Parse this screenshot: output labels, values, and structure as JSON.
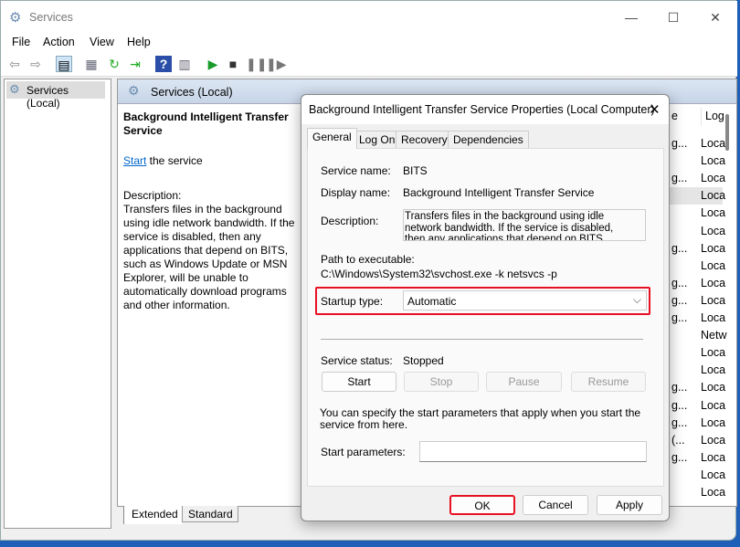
{
  "window": {
    "title": "Services",
    "icon": "gears-icon"
  },
  "menu": [
    "File",
    "Action",
    "View",
    "Help"
  ],
  "toolbar": [
    "back-icon",
    "forward-icon",
    "show-hide-console-tree-icon",
    "properties-icon",
    "refresh-icon",
    "export-list-icon",
    "help-icon",
    "show-action-pane-icon",
    "start-service-icon",
    "stop-service-icon",
    "pause-service-icon",
    "restart-service-icon"
  ],
  "tree": {
    "item": "Services (Local)"
  },
  "pane": {
    "header": "Services (Local)",
    "service_title": "Background Intelligent Transfer Service",
    "start_link": "Start",
    "start_suffix": " the service",
    "description_label": "Description:",
    "description": "Transfers files in the background using idle network bandwidth. If the service is disabled, then any applications that depend on BITS, such as Windows Update or MSN Explorer, will be unable to automatically download programs and other information."
  },
  "list": {
    "headers": [
      "e",
      "Log"
    ],
    "rows": [
      [
        "g...",
        "Loca"
      ],
      [
        "",
        "Loca"
      ],
      [
        "g...",
        "Loca"
      ],
      [
        "",
        "Loca"
      ],
      [
        "",
        "Loca"
      ],
      [
        "",
        "Loca"
      ],
      [
        "g...",
        "Loca"
      ],
      [
        "",
        "Loca"
      ],
      [
        "g...",
        "Loca"
      ],
      [
        "g...",
        "Loca"
      ],
      [
        "g...",
        "Loca"
      ],
      [
        "",
        "Netw"
      ],
      [
        "",
        "Loca"
      ],
      [
        "",
        "Loca"
      ],
      [
        "g...",
        "Loca"
      ],
      [
        "g...",
        "Loca"
      ],
      [
        "g...",
        "Loca"
      ],
      [
        "(...",
        "Loca"
      ],
      [
        "g...",
        "Loca"
      ],
      [
        "",
        "Loca"
      ],
      [
        "",
        "Loca"
      ]
    ],
    "selected_row": 3
  },
  "bottom_tabs": [
    "Extended",
    "Standard"
  ],
  "dialog": {
    "title": "Background Intelligent Transfer Service Properties (Local Computer)",
    "tabs": [
      "General",
      "Log On",
      "Recovery",
      "Dependencies"
    ],
    "service_name_label": "Service name:",
    "service_name": "BITS",
    "display_name_label": "Display name:",
    "display_name": "Background Intelligent Transfer Service",
    "description_label": "Description:",
    "description": "Transfers files in the background using idle network bandwidth. If the service is disabled, then any applications that depend on BITS, such as Windows",
    "path_label": "Path to executable:",
    "path": "C:\\Windows\\System32\\svchost.exe -k netsvcs -p",
    "startup_label": "Startup type:",
    "startup_value": "Automatic",
    "status_label": "Service status:",
    "status_value": "Stopped",
    "buttons": {
      "start": "Start",
      "stop": "Stop",
      "pause": "Pause",
      "resume": "Resume"
    },
    "params_hint": "You can specify the start parameters that apply when you start the service from here.",
    "params_label": "Start parameters:",
    "params_value": "",
    "ok": "OK",
    "cancel": "Cancel",
    "apply": "Apply",
    "highlight_color": "#e81123"
  }
}
